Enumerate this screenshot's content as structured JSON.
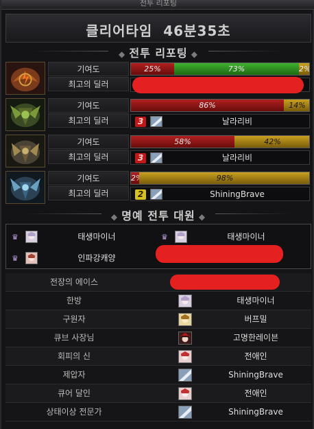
{
  "window": {
    "title": "전투 리포팅"
  },
  "clear_time": {
    "label": "클리어타임",
    "value": "46분35초"
  },
  "report_header": "전투 리포팅",
  "contribution_label": "기여도",
  "best_dealer_label": "최고의 딜러",
  "bosses": [
    {
      "icon": "flame-boss-icon",
      "segments": [
        {
          "color": "red",
          "value": 25,
          "label": "25%"
        },
        {
          "color": "green",
          "value": 73,
          "label": "73%"
        },
        {
          "color": "gold",
          "value": 2,
          "label": "2%"
        }
      ],
      "best_dealer": {
        "rank": "",
        "name": ""
      }
    },
    {
      "icon": "nature-boss-icon",
      "segments": [
        {
          "color": "red",
          "value": 86,
          "label": "86%"
        },
        {
          "color": "gold",
          "value": 14,
          "label": "14%"
        }
      ],
      "best_dealer": {
        "rank": "3",
        "rank_color": "red",
        "name": "날라리비"
      }
    },
    {
      "icon": "stone-boss-icon",
      "segments": [
        {
          "color": "red",
          "value": 58,
          "label": "58%"
        },
        {
          "color": "gold",
          "value": 42,
          "label": "42%"
        }
      ],
      "best_dealer": {
        "rank": "3",
        "rank_color": "red",
        "name": "날라리비"
      }
    },
    {
      "icon": "ice-boss-icon",
      "segments": [
        {
          "color": "red",
          "value": 2,
          "label": "2%"
        },
        {
          "color": "gold",
          "value": 98,
          "label": "98%"
        }
      ],
      "best_dealer": {
        "rank": "2",
        "rank_color": "gold",
        "name": "ShiningBrave"
      }
    }
  ],
  "honor_header": "명예 전투 대원",
  "honor_members": [
    {
      "name": "태생마이너"
    },
    {
      "name": "태생마이너"
    },
    {
      "name": "인파강캐양"
    },
    {
      "name": ""
    }
  ],
  "awards": [
    {
      "title": "전장의 에이스",
      "name": ""
    },
    {
      "title": "한방",
      "name": "태생마이너"
    },
    {
      "title": "구원자",
      "name": "버프밀"
    },
    {
      "title": "큐브 사장님",
      "name": "고명한레이븐"
    },
    {
      "title": "회피의 신",
      "name": "전애인"
    },
    {
      "title": "제압자",
      "name": "ShiningBrave"
    },
    {
      "title": "큐어 달인",
      "name": "전애인"
    },
    {
      "title": "상태이상 전문가",
      "name": "ShiningBrave"
    }
  ],
  "colors": {
    "red": "#b02020",
    "green": "#40b030",
    "gold": "#c8a020",
    "redaction": "#e42020"
  }
}
